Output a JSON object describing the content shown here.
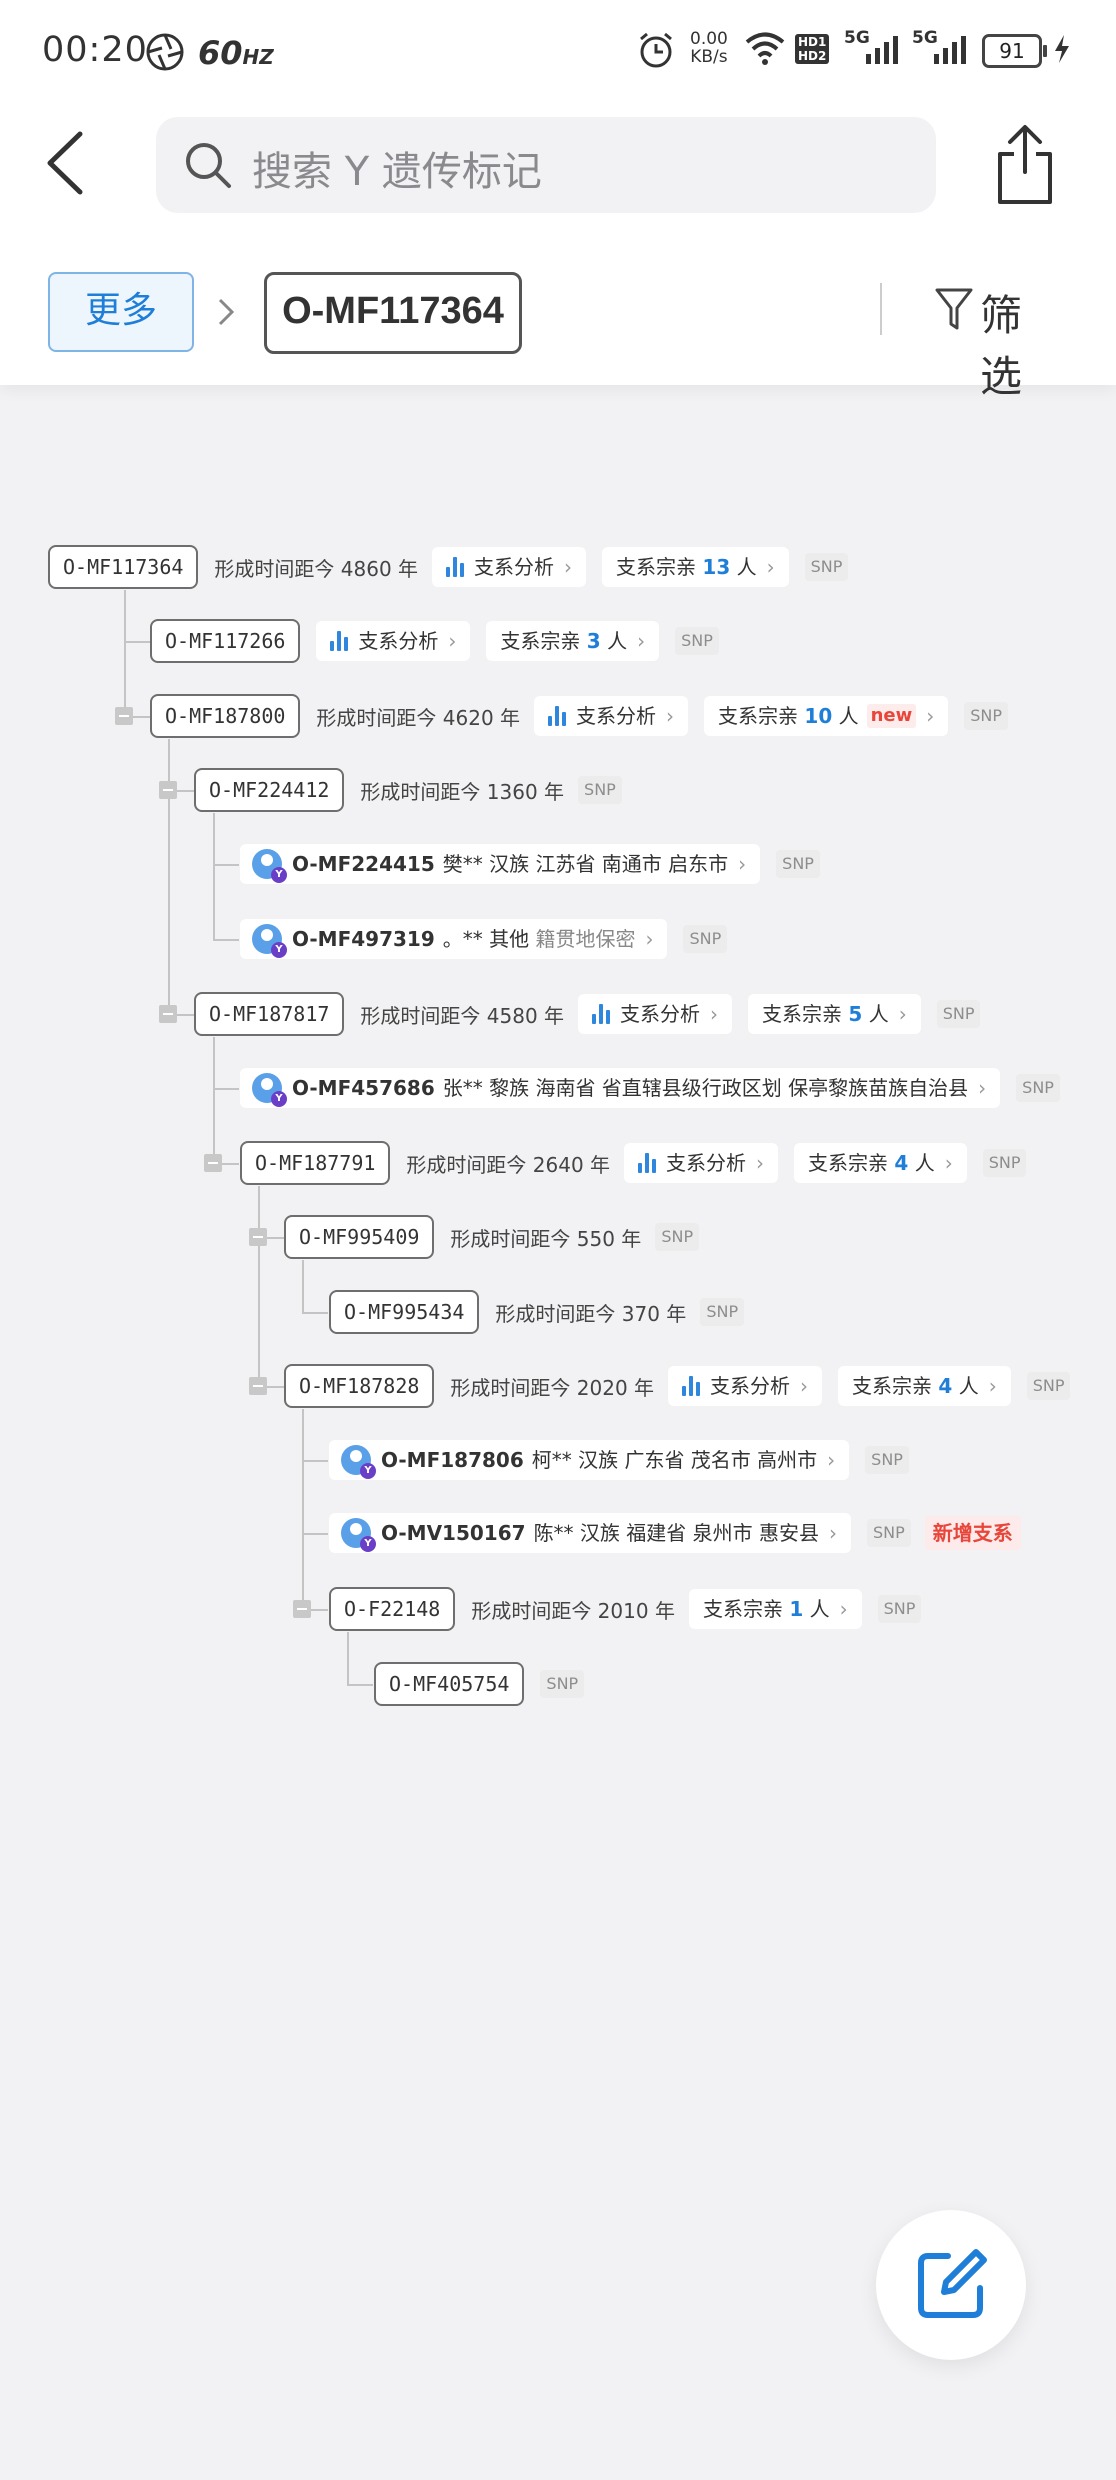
{
  "status_bar": {
    "time": "00:20",
    "refresh_rate": "60",
    "refresh_unit": "HZ",
    "net_speed": "0.00",
    "net_unit": "KB/s",
    "hd1": "HD1",
    "hd2": "HD2",
    "sig1": "5G",
    "sig2": "5G",
    "battery": "91"
  },
  "search": {
    "placeholder": "搜索 Y 遗传标记"
  },
  "breadcrumb": {
    "more_label": "更多",
    "current": "O-MF117364"
  },
  "filter": {
    "label": "筛选"
  },
  "tree": {
    "r0": {
      "node": "O-MF117364",
      "time": "形成时间距今 4860 年",
      "analysis": "支系分析",
      "clan_prefix": "支系宗亲",
      "clan_count": "13",
      "clan_suffix": "人",
      "snp": "SNP"
    },
    "r1": {
      "node": "O-MF117266",
      "analysis": "支系分析",
      "clan_prefix": "支系宗亲",
      "clan_count": "3",
      "clan_suffix": "人",
      "snp": "SNP"
    },
    "r2": {
      "node": "O-MF187800",
      "time": "形成时间距今 4620 年",
      "analysis": "支系分析",
      "clan_prefix": "支系宗亲",
      "clan_count": "10",
      "clan_suffix": "人",
      "new_tag": "new",
      "snp": "SNP"
    },
    "r3": {
      "node": "O-MF224412",
      "time": "形成时间距今 1360 年",
      "snp": "SNP"
    },
    "r4": {
      "id": "O-MF224415",
      "text": "樊** 汉族 江苏省 南通市 启东市",
      "snp": "SNP"
    },
    "r5": {
      "id": "O-MF497319",
      "text": "。** 其他",
      "muted": "籍贯地保密",
      "snp": "SNP"
    },
    "r6": {
      "node": "O-MF187817",
      "time": "形成时间距今 4580 年",
      "analysis": "支系分析",
      "clan_prefix": "支系宗亲",
      "clan_count": "5",
      "clan_suffix": "人",
      "snp": "SNP"
    },
    "r7": {
      "id": "O-MF457686",
      "text": "张** 黎族 海南省 省直辖县级行政区划 保亭黎族苗族自治县",
      "snp": "SNP"
    },
    "r8": {
      "node": "O-MF187791",
      "time": "形成时间距今 2640 年",
      "analysis": "支系分析",
      "clan_prefix": "支系宗亲",
      "clan_count": "4",
      "clan_suffix": "人",
      "snp": "SNP"
    },
    "r9": {
      "node": "O-MF995409",
      "time": "形成时间距今 550 年",
      "snp": "SNP"
    },
    "r10": {
      "node": "O-MF995434",
      "time": "形成时间距今 370 年",
      "snp": "SNP"
    },
    "r11": {
      "node": "O-MF187828",
      "time": "形成时间距今 2020 年",
      "analysis": "支系分析",
      "clan_prefix": "支系宗亲",
      "clan_count": "4",
      "clan_suffix": "人",
      "snp": "SNP"
    },
    "r12": {
      "id": "O-MF187806",
      "text": "柯** 汉族 广东省 茂名市 高州市",
      "snp": "SNP"
    },
    "r13": {
      "id": "O-MV150167",
      "text": "陈** 汉族 福建省 泉州市 惠安县",
      "snp": "SNP",
      "new_branch": "新增支系"
    },
    "r14": {
      "node": "O-F22148",
      "time": "形成时间距今 2010 年",
      "clan_prefix": "支系宗亲",
      "clan_count": "1",
      "clan_suffix": "人",
      "snp": "SNP"
    },
    "r15": {
      "node": "O-MF405754",
      "snp": "SNP"
    }
  },
  "colors": {
    "accent": "#1f7ed8",
    "alert": "#e8463a",
    "chart_bars": "#2f86dd",
    "avatar": "#5aa0e8",
    "badge": "#6a3fc8"
  },
  "icons": [
    "back-arrow-icon",
    "search-icon",
    "share-icon",
    "chevron-right-icon",
    "filter-icon",
    "bar-chart-icon",
    "user-avatar-icon",
    "edit-icon"
  ]
}
